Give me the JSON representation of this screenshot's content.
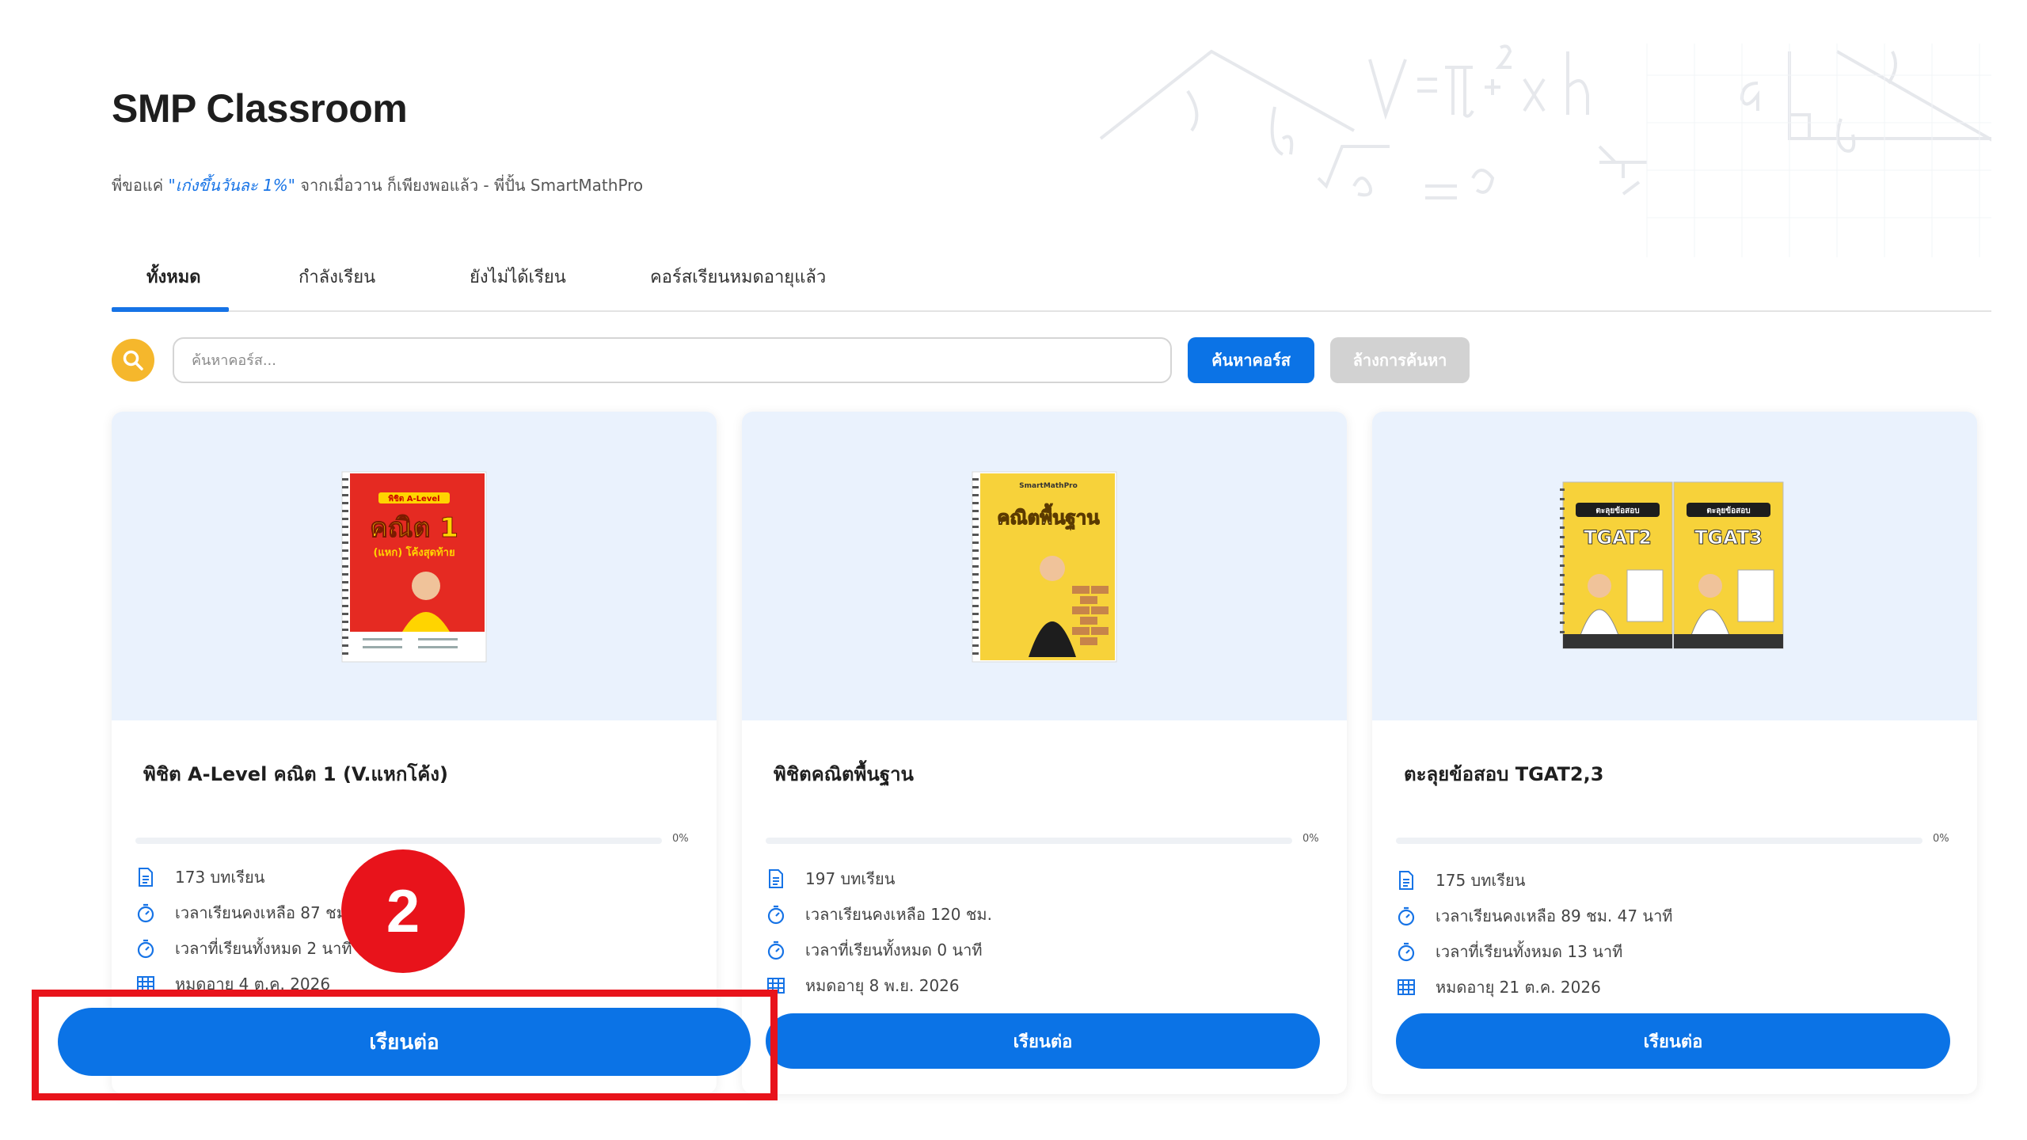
{
  "header": {
    "title": "SMP Classroom",
    "subtitle_prefix": "พี่ขอแค่ ",
    "subtitle_highlight": "\"เก่งขึ้นวันละ 1%\"",
    "subtitle_suffix": " จากเมื่อวาน ก็เพียงพอแล้ว - พี่ปั้น SmartMathPro"
  },
  "tabs": [
    {
      "label": "ทั้งหมด",
      "active": true
    },
    {
      "label": "กำลังเรียน",
      "active": false
    },
    {
      "label": "ยังไม่ได้เรียน",
      "active": false
    },
    {
      "label": "คอร์สเรียนหมดอายุแล้ว",
      "active": false
    }
  ],
  "search": {
    "placeholder": "ค้นหาคอร์ส...",
    "search_button": "ค้นหาคอร์ส",
    "clear_button": "ล้างการค้นหา"
  },
  "courses": [
    {
      "title": "พิชิต A-Level คณิต 1 (V.แหกโค้ง)",
      "progress_label": "0%",
      "progress": 0,
      "lessons": "173 บทเรียน",
      "time_left": "เวลาเรียนคงเหลือ 87 ชม.",
      "time_spent": "เวลาที่เรียนทั้งหมด 2 นาที",
      "expiry": "หมดอายุ 4 ต.ค. 2026",
      "button": "เรียนต่อ",
      "book_title": "คณิต 1",
      "book_subtitle": "(แหก) โค้งสุดท้าย",
      "book_tag": "พิชิต A-Level"
    },
    {
      "title": "พิชิตคณิตพื้นฐาน",
      "progress_label": "0%",
      "progress": 0,
      "lessons": "197 บทเรียน",
      "time_left": "เวลาเรียนคงเหลือ 120 ชม.",
      "time_spent": "เวลาที่เรียนทั้งหมด 0 นาที",
      "expiry": "หมดอายุ 8 พ.ย. 2026",
      "button": "เรียนต่อ",
      "book_title": "คณิตพื้นฐาน",
      "book_tag": "SmartMathPro"
    },
    {
      "title": "ตะลุยข้อสอบ TGAT2,3",
      "progress_label": "0%",
      "progress": 0,
      "lessons": "175 บทเรียน",
      "time_left": "เวลาเรียนคงเหลือ 89 ชม. 47 นาที",
      "time_spent": "เวลาที่เรียนทั้งหมด 13 นาที",
      "expiry": "หมดอายุ 21 ต.ค. 2026",
      "button": "เรียนต่อ",
      "book_left": "TGAT2",
      "book_right": "TGAT3",
      "book_tag": "ตะลุยข้อสอบ"
    }
  ],
  "annotation": {
    "step_number": "2",
    "highlighted_button": "เรียนต่อ"
  },
  "colors": {
    "primary": "#0b73e6",
    "search_icon_bg": "#f5b72c",
    "annotation_red": "#e8131b",
    "thumb_bg": "#eaf2fd"
  }
}
